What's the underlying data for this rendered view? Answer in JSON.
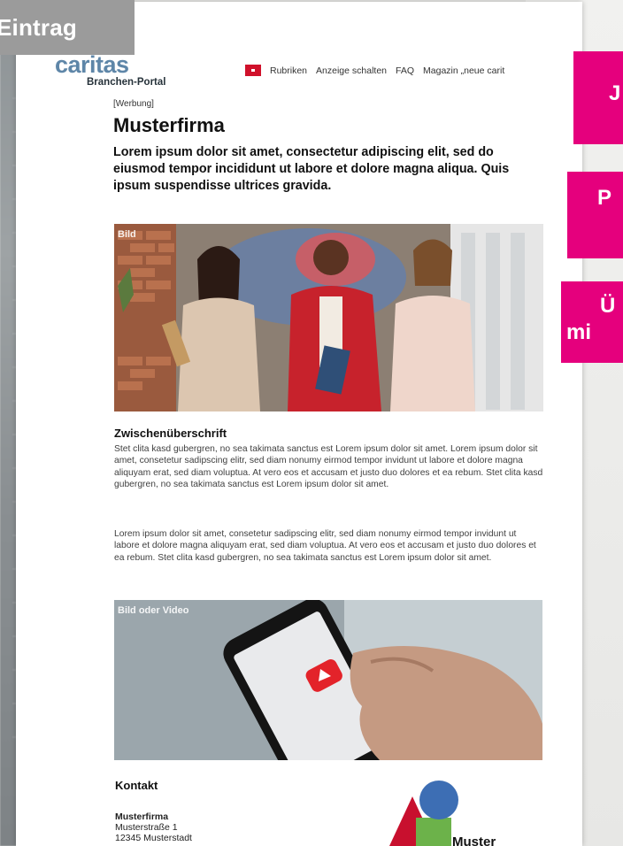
{
  "badge": {
    "label": "Eintrag"
  },
  "brand": {
    "name": "caritas",
    "subtitle": "Branchen-Portal"
  },
  "nav": {
    "items": [
      "Rubriken",
      "Anzeige schalten",
      "FAQ",
      "Magazin „neue carit"
    ]
  },
  "promos": [
    {
      "label": "J"
    },
    {
      "label": "P"
    },
    {
      "line1": "Ü",
      "line2": "mi"
    }
  ],
  "article": {
    "ad_tag": "[Werbung]",
    "company": "Musterfirma",
    "intro": "Lorem ipsum dolor sit amet, consectetur adipiscing elit, sed do eiusmod tempor incididunt ut labore et dolore magna aliqua. Quis ipsum suspendisse ultrices gravida.",
    "image_label": "Bild",
    "subheading": "Zwischenüberschrift",
    "paragraph1": "Stet clita kasd gubergren, no sea takimata sanctus est Lorem ipsum dolor sit amet. Lorem ipsum dolor sit amet, consetetur sadipscing elitr, sed diam nonumy eirmod tempor invidunt ut labore et dolore magna aliquyam erat, sed diam voluptua. At vero eos et accusam et justo duo dolores et ea rebum. Stet clita kasd gubergren, no sea takimata sanctus est Lorem ipsum dolor sit amet.",
    "paragraph2": "Lorem ipsum dolor sit amet, consetetur sadipscing elitr, sed diam nonumy eirmod tempor invidunt ut labore et dolore magna aliquyam erat, sed diam voluptua. At vero eos et accusam et justo duo dolores et ea rebum. Stet clita kasd gubergren, no sea takimata sanctus est Lorem ipsum dolor sit amet.",
    "video_label": "Bild oder Video"
  },
  "contact": {
    "title": "Kontakt",
    "name": "Musterfirma",
    "street": "Musterstraße 1",
    "city": "12345 Musterstadt",
    "logo_text": "Muster"
  },
  "colors": {
    "magenta": "#e5007d",
    "caritas_blue": "#5e86a8",
    "flag_red": "#d0112b",
    "youtube_red": "#e3232a"
  },
  "icons": [
    "caritas-flame-icon",
    "youtube-play-icon"
  ]
}
